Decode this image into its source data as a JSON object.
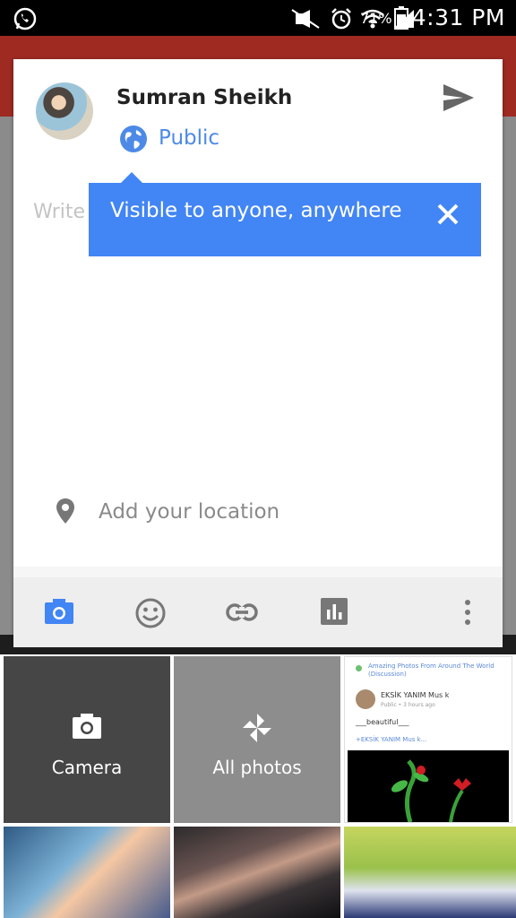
{
  "status_bar": {
    "battery_percent": "71%",
    "time": "4:31 PM",
    "icons": [
      "whatsapp-icon",
      "mute-icon",
      "alarm-icon",
      "wifi-icon",
      "signal-icon",
      "battery-icon"
    ]
  },
  "composer": {
    "user_name": "Sumran Sheikh",
    "privacy": "Public",
    "placeholder_visible": "Write",
    "tooltip_text": "Visible to anyone, anywhere",
    "location_label": "Add your location"
  },
  "toolbar": {
    "items": [
      "camera-icon",
      "emoji-icon",
      "link-icon",
      "poll-icon",
      "more-vert-icon"
    ],
    "accent": "#4285f4"
  },
  "gallery": {
    "camera_label": "Camera",
    "all_photos_label": "All photos",
    "thumb3_title": "Amazing Photos From Around The World (Discussion)",
    "thumb3_user": "EKSİK YANIM Mus k",
    "thumb3_meta": "Public • 3 hours ago",
    "thumb3_text": "___beautiful___",
    "thumb3_tag": "+EKSİK YANIM Mus k..."
  },
  "colors": {
    "brand_red": "#9e2a22",
    "link_blue": "#4d8ae7",
    "tooltip_blue": "#4285f4"
  }
}
